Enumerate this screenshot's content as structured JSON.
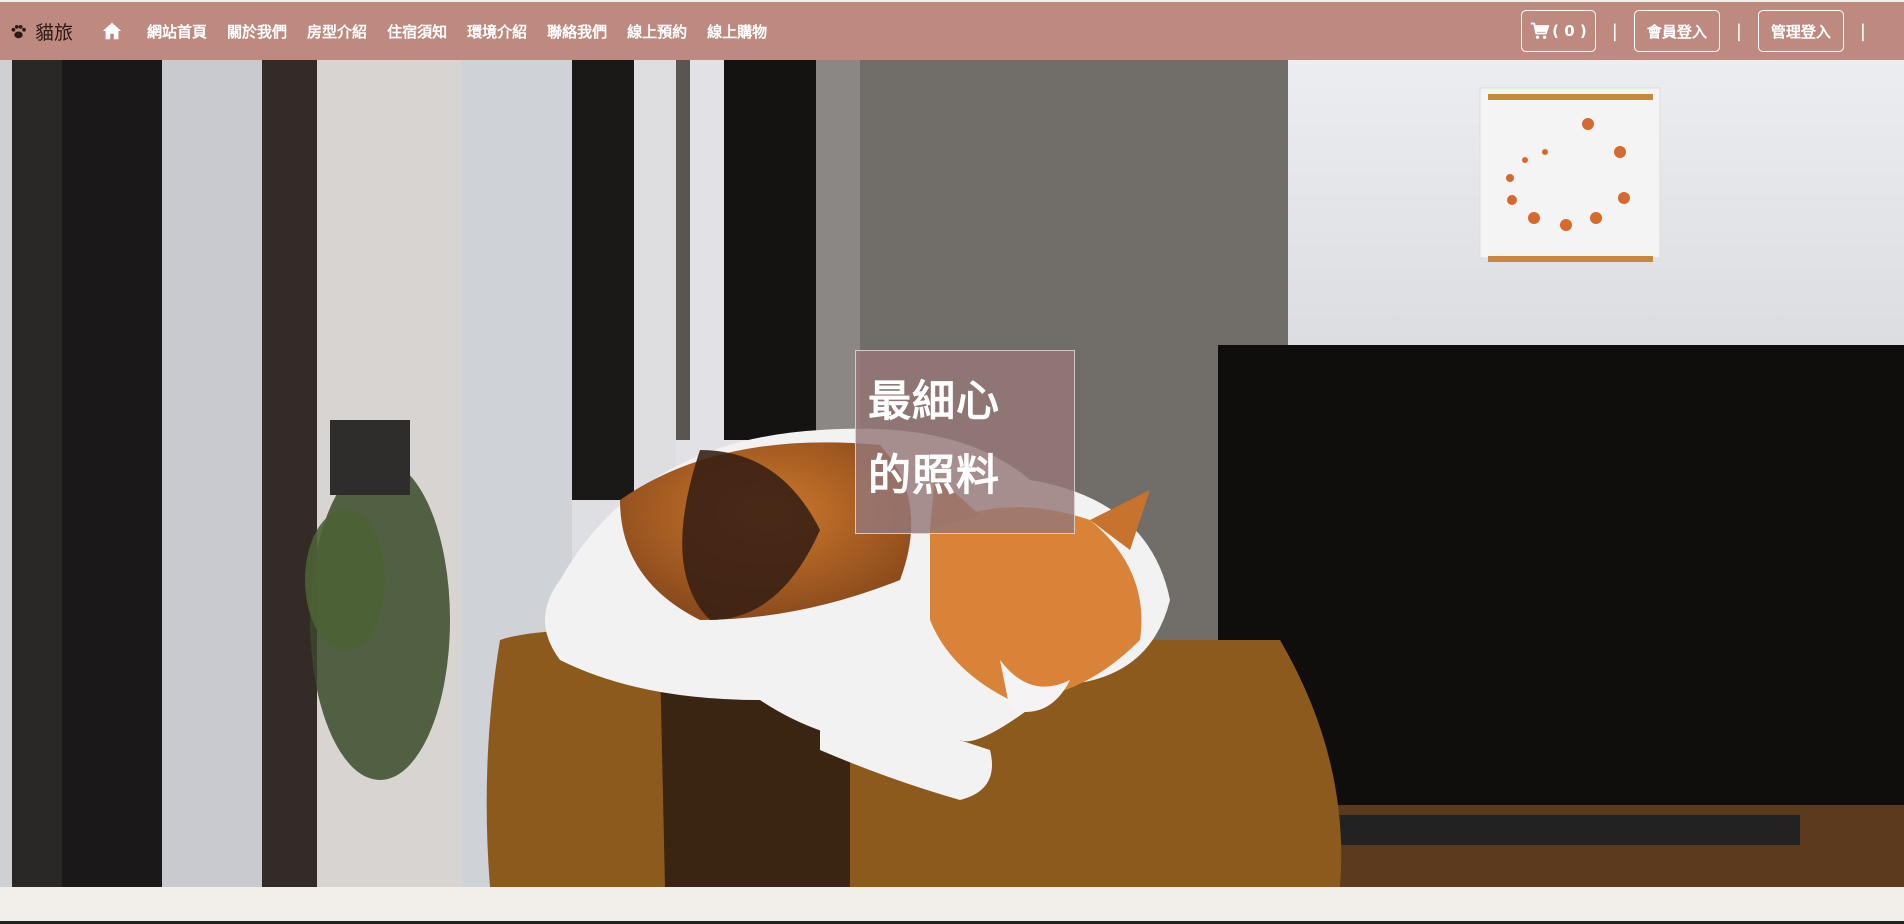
{
  "header": {
    "brand": "貓旅",
    "nav": [
      "網站首頁",
      "關於我們",
      "房型介紹",
      "住宿須知",
      "環境介紹",
      "聯絡我們",
      "線上預約",
      "線上購物"
    ],
    "cart_count": "( 0 )",
    "separator": "|",
    "member_login": "會員登入",
    "admin_login": "管理登入"
  },
  "hero": {
    "line1": "最細心",
    "line2": "的照料"
  },
  "colors": {
    "navbar": "#be8a80",
    "tagline_box": "#967878"
  },
  "icons": [
    "paw-icon",
    "home-icon",
    "cart-icon"
  ]
}
